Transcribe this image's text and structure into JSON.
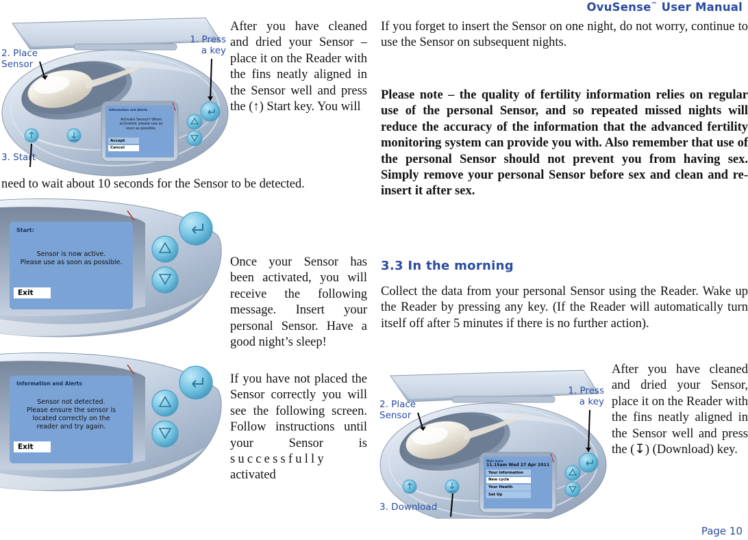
{
  "header": {
    "title": "OvuSense",
    "trademark": "™",
    "title_suffix": " User Manual"
  },
  "footer": {
    "page_label": "Page 10"
  },
  "left_column": {
    "paragraph_1": "After you have cleaned and dried your Sensor – place it on the Reader with the fins neatly aligned in the Sensor well and press the (↑) Start key. You will",
    "paragraph_1_wrap": "need to wait about 10 seconds for the Sensor to be detected.",
    "paragraph_2": "Once your Sensor has been activated, you will receive the following message. Insert your personal Sensor. Have a good night’s sleep!",
    "paragraph_3a": "If you have not placed the Sensor correctly you will see the following screen. Follow instructions until your Sensor is ",
    "paragraph_3b": "successfully",
    "paragraph_3c": " activated"
  },
  "right_column": {
    "paragraph_1": "If you forget to insert the Sensor on one night, do not worry, continue to use the Sensor on subsequent nights.",
    "paragraph_2_bold": "Please note – the quality of fertility information relies on regular use of the personal Sensor, and so repeated missed nights will reduce the accuracy of the information that the advanced fertility monitoring system can provide you with. Also remember that use of the personal Sensor should not prevent you from having sex. Simply remove your personal Sensor before sex and clean and re-insert it after sex.",
    "section_heading": "3.3 In the morning",
    "paragraph_3": "Collect the data from your personal Sensor using the Reader. Wake up the Reader by pressing any key. (If the Reader will automatically turn itself off after 5 minutes if there is no further action).",
    "paragraph_4": "After you have cleaned and dried your Sensor, place it on the Reader with the fins neatly aligned in the Sensor well and press the (↧) (Download) key."
  },
  "figure_activate": {
    "callout_place_sensor": "2. Place\nSensor",
    "callout_press_key": "1. Press\na key",
    "callout_start": "3. Start",
    "screen": {
      "title": "Information and Alerts",
      "message": "Activate Sensor? When activated, please use as soon as possible.",
      "button_accept": "Accept",
      "button_cancel": "Cancel"
    }
  },
  "figure_active": {
    "screen": {
      "title": "Start:",
      "message_line_1": "Sensor is now active.",
      "message_line_2": "Please use as soon as possible.",
      "button_exit": "Exit"
    }
  },
  "figure_not_detected": {
    "screen": {
      "title": "Information and Alerts",
      "message_line_1": "Sensor not detected.",
      "message_line_2": "Please ensure the sensor is",
      "message_line_3": "located correctly on the",
      "message_line_4": "reader and try again.",
      "button_exit": "Exit"
    }
  },
  "figure_download": {
    "callout_place_sensor": "2. Place\nSensor",
    "callout_press_key": "1. Press\na key",
    "callout_download": "3. Download",
    "screen": {
      "title": "Main menu",
      "timestamp": "11.15am Wed 27 Apr 2011",
      "menu_items": [
        "Your information",
        "New cycle",
        "Your Health",
        "Set Up"
      ],
      "selected_index": 1
    }
  },
  "colors": {
    "brand_blue": "#2a4ba0",
    "lcd_background": "#7ba3d6",
    "key_blue": "#6fc0e0",
    "device_body": "#b9c6da"
  }
}
